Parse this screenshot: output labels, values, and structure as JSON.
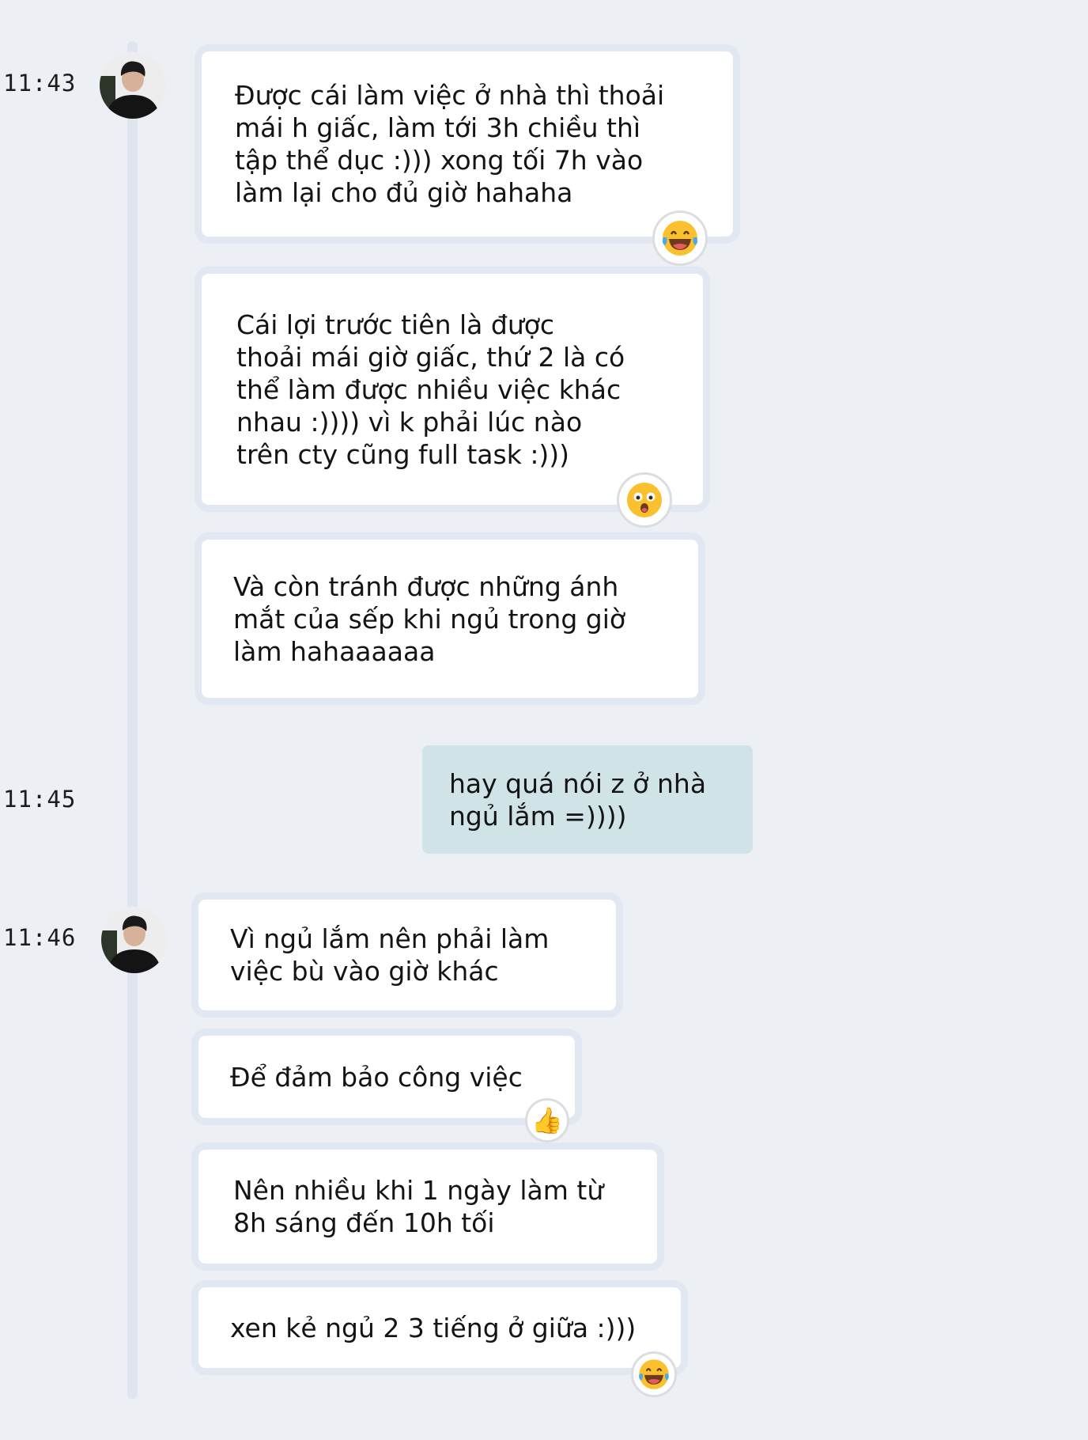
{
  "timestamps": [
    "11:43",
    "11:45",
    "11:46"
  ],
  "messages": [
    {
      "text": "Được cái làm việc ở nhà thì thoải\nmái h giấc, làm tới 3h chiều thì\ntập thể dục :))) xong tối 7h vào\nlàm lại cho đủ giờ hahaha",
      "reaction": "laughing-tears-icon"
    },
    {
      "text": "Cái lợi trước tiên là được\nthoải mái giờ giấc, thứ 2 là có\nthể làm được nhiều việc khác\nnhau :)))) vì k phải lúc nào\ntrên cty cũng full task :)))",
      "reaction": "surprised-face-icon"
    },
    {
      "text": "Và còn tránh được những ánh\nmắt của sếp khi ngủ trong giờ\nlàm hahaaaaaa"
    },
    {
      "text": "hay quá nói z ở nhà\nngủ lắm =))))"
    },
    {
      "text": "Vì ngủ lắm nên phải làm\nviệc bù vào giờ khác"
    },
    {
      "text": "Để đảm bảo công việc",
      "reaction": "thumbs-up-icon",
      "reaction_glyph": "👍"
    },
    {
      "text": "Nên nhiều khi 1 ngày làm từ\n8h sáng đến 10h tối"
    },
    {
      "text": "xen kẻ ngủ 2 3 tiếng ở giữa :)))",
      "reaction": "laughing-tears-icon"
    }
  ],
  "colors": {
    "background": "#eceff4",
    "received_bubble": "#ffffff",
    "sent_bubble": "#d0e3e6",
    "emoji_yellow": "#fbc02d",
    "tear_blue": "#4aa9e9"
  }
}
